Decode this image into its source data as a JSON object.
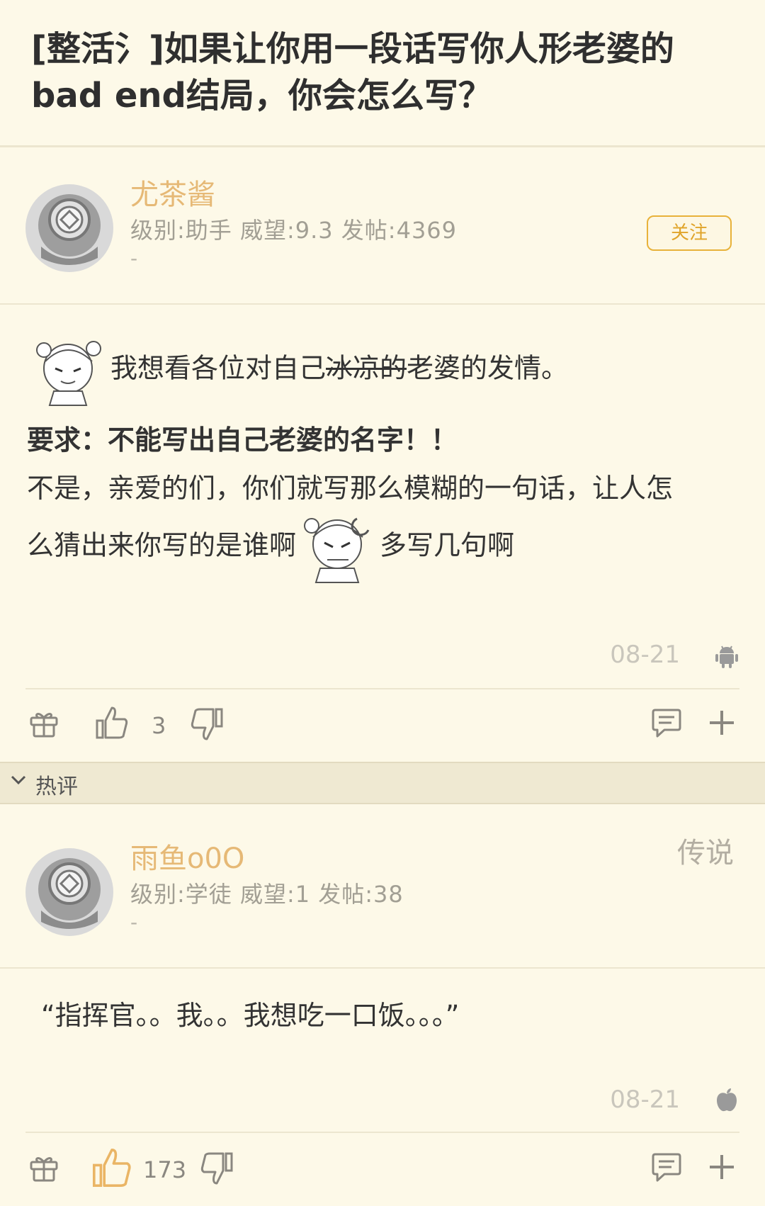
{
  "thread": {
    "title": "[整活氵]如果让你用一段话写你人形老婆的bad end结局，你会怎么写？"
  },
  "op": {
    "username": "尤茶酱",
    "info": "级别:助手 威望:9.3 发帖:4369",
    "dash": "-",
    "follow_label": "关注",
    "body": {
      "line1_pre": "我想看各位对自己",
      "line1_strike": "冰凉的",
      "line1_post": "老婆的发情。",
      "line2": "要求：不能写出自己老婆的名字！！",
      "line3": "不是，亲爱的们，你们就写那么模糊的一句话，让人怎",
      "line4_pre": "么猜出来你写的是谁啊",
      "line4_post": "多写几句啊"
    },
    "date": "08-21",
    "like_count": "3"
  },
  "hot": {
    "label": "热评"
  },
  "reply": {
    "username": "雨鱼o0O",
    "rank": "传说",
    "info": "级别:学徒 威望:1 发帖:38",
    "dash": "-",
    "body": "“指挥官。。我。。我想吃一口饭。。。”",
    "date": "08-21",
    "like_count": "173"
  },
  "colors": {
    "background": "#fdf9e8",
    "username": "#e6b976",
    "accent": "#e8b23a",
    "liked": "#eab565"
  },
  "icons": [
    "helmet-avatar-icon",
    "sticker-icon",
    "android-icon",
    "apple-icon",
    "gift-icon",
    "thumbs-up-icon",
    "thumbs-down-icon",
    "comment-icon",
    "plus-icon",
    "chevron-down-icon"
  ]
}
